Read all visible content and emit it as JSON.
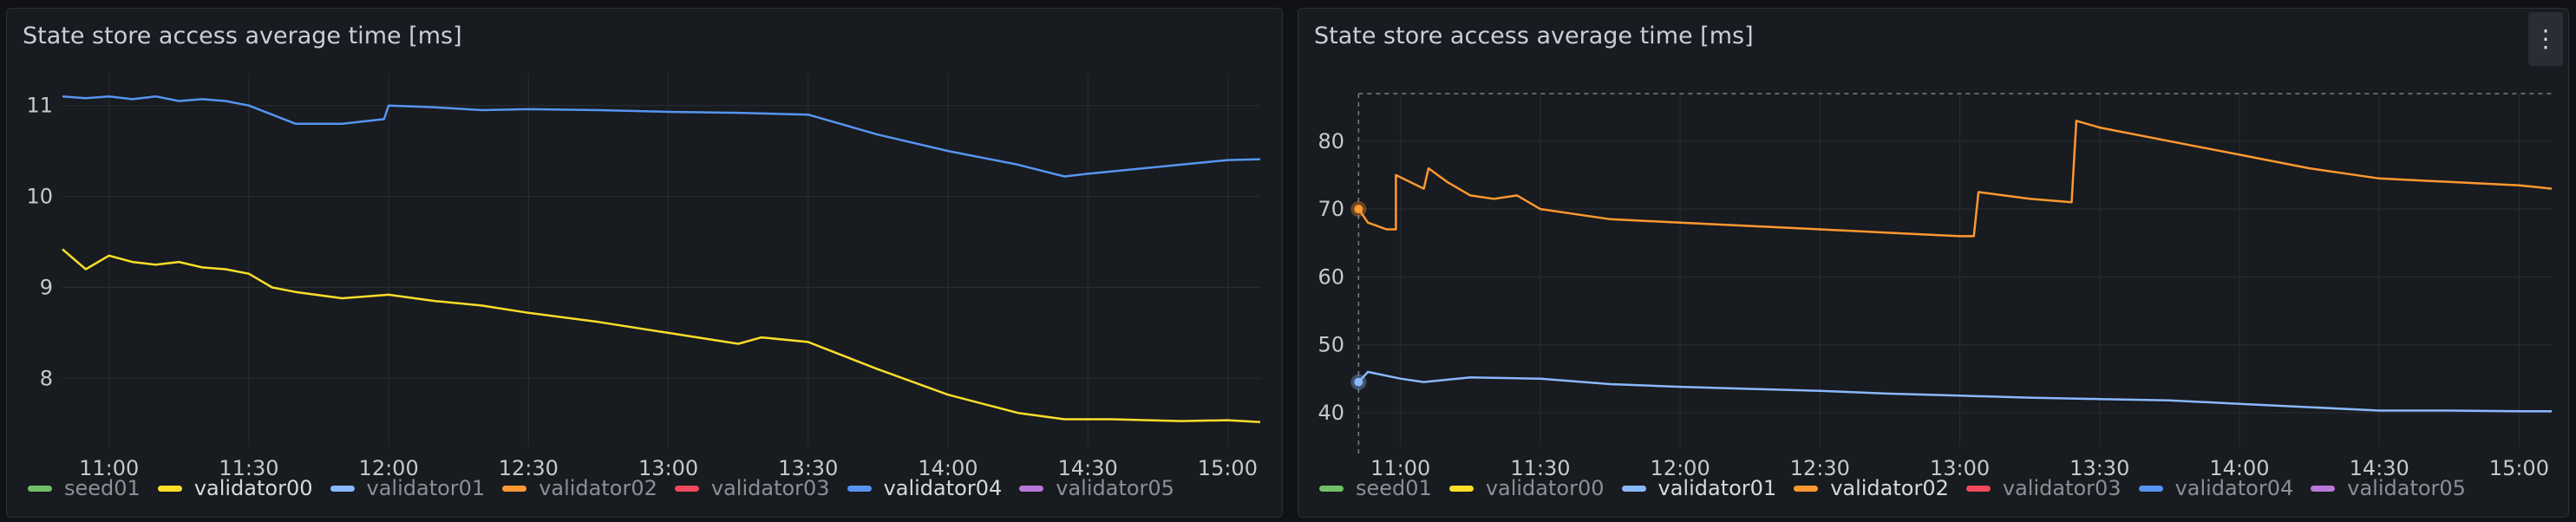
{
  "panels": [
    {
      "title": "State store access average time [ms]"
    },
    {
      "title": "State store access average time [ms]",
      "menu_icon": "⋮"
    }
  ],
  "colors": {
    "seed01": "#73bf69",
    "validator00": "#fade2a",
    "validator01": "#8ab8ff",
    "validator02": "#ff9830",
    "validator03": "#f2495c",
    "validator04": "#5794f2",
    "validator05": "#b877d9",
    "grid": "#2a2d33",
    "axis_text": "#c7c8cc"
  },
  "chart_data": [
    {
      "type": "line",
      "title": "State store access average time [ms]",
      "xlabel": "",
      "ylabel": "",
      "x_ticks": [
        "11:00",
        "11:30",
        "12:00",
        "12:30",
        "13:00",
        "13:30",
        "14:00",
        "14:30",
        "15:00"
      ],
      "y_ticks": [
        8,
        9,
        10,
        11
      ],
      "xlim": [
        "10:50",
        "15:07"
      ],
      "ylim": [
        7.25,
        11.35
      ],
      "grid": true,
      "legend_position": "bottom-left",
      "legend": [
        {
          "name": "seed01",
          "active": false
        },
        {
          "name": "validator00",
          "active": true
        },
        {
          "name": "validator01",
          "active": false
        },
        {
          "name": "validator02",
          "active": false
        },
        {
          "name": "validator03",
          "active": false
        },
        {
          "name": "validator04",
          "active": true
        },
        {
          "name": "validator05",
          "active": false
        }
      ],
      "series": [
        {
          "name": "validator04",
          "x": [
            "10:50",
            "10:55",
            "11:00",
            "11:05",
            "11:10",
            "11:15",
            "11:20",
            "11:25",
            "11:30",
            "11:40",
            "11:50",
            "11:59",
            "12:00",
            "12:10",
            "12:20",
            "12:30",
            "12:45",
            "13:00",
            "13:15",
            "13:30",
            "13:45",
            "14:00",
            "14:15",
            "14:25",
            "14:30",
            "14:40",
            "14:50",
            "15:00",
            "15:07"
          ],
          "values": [
            11.1,
            11.08,
            11.1,
            11.07,
            11.1,
            11.05,
            11.07,
            11.05,
            11.0,
            10.8,
            10.8,
            10.85,
            11.0,
            10.98,
            10.95,
            10.96,
            10.95,
            10.93,
            10.92,
            10.9,
            10.68,
            10.5,
            10.35,
            10.22,
            10.25,
            10.3,
            10.35,
            10.4,
            10.41
          ]
        },
        {
          "name": "validator00",
          "x": [
            "10:50",
            "10:55",
            "11:00",
            "11:05",
            "11:10",
            "11:15",
            "11:20",
            "11:25",
            "11:30",
            "11:35",
            "11:40",
            "11:50",
            "12:00",
            "12:10",
            "12:20",
            "12:30",
            "12:45",
            "13:00",
            "13:15",
            "13:20",
            "13:30",
            "13:45",
            "14:00",
            "14:15",
            "14:25",
            "14:35",
            "14:50",
            "15:00",
            "15:07"
          ],
          "values": [
            9.42,
            9.2,
            9.35,
            9.28,
            9.25,
            9.28,
            9.22,
            9.2,
            9.15,
            9.0,
            8.95,
            8.88,
            8.92,
            8.85,
            8.8,
            8.72,
            8.62,
            8.5,
            8.38,
            8.45,
            8.4,
            8.1,
            7.82,
            7.62,
            7.55,
            7.55,
            7.53,
            7.54,
            7.52
          ]
        }
      ]
    },
    {
      "type": "line",
      "title": "State store access average time [ms]",
      "xlabel": "",
      "ylabel": "",
      "x_ticks": [
        "11:00",
        "11:30",
        "12:00",
        "12:30",
        "13:00",
        "13:30",
        "14:00",
        "14:30",
        "15:00"
      ],
      "y_ticks": [
        40,
        50,
        60,
        70,
        80
      ],
      "xlim": [
        "10:50",
        "15:07"
      ],
      "ylim": [
        35,
        87
      ],
      "grid": true,
      "legend_position": "bottom-left",
      "legend": [
        {
          "name": "seed01",
          "active": false
        },
        {
          "name": "validator00",
          "active": false
        },
        {
          "name": "validator01",
          "active": true
        },
        {
          "name": "validator02",
          "active": true
        },
        {
          "name": "validator03",
          "active": false
        },
        {
          "name": "validator04",
          "active": false
        },
        {
          "name": "validator05",
          "active": false
        }
      ],
      "series": [
        {
          "name": "validator02",
          "x": [
            "10:51",
            "10:53",
            "10:57",
            "10:59",
            "10:59",
            "11:02",
            "11:05",
            "11:06",
            "11:10",
            "11:15",
            "11:20",
            "11:25",
            "11:30",
            "11:45",
            "12:00",
            "12:15",
            "12:30",
            "12:45",
            "13:00",
            "13:03",
            "13:04",
            "13:15",
            "13:24",
            "13:25",
            "13:30",
            "13:45",
            "14:00",
            "14:15",
            "14:30",
            "14:45",
            "15:00",
            "15:07"
          ],
          "values": [
            70,
            68,
            67,
            67,
            75,
            74,
            73,
            76,
            74,
            72,
            71.5,
            72,
            70,
            68.5,
            68,
            67.5,
            67,
            66.5,
            66,
            66,
            72.5,
            71.5,
            71,
            83,
            82,
            80,
            78,
            76,
            74.5,
            74,
            73.5,
            73
          ]
        },
        {
          "name": "validator01",
          "x": [
            "10:51",
            "10:53",
            "11:00",
            "11:05",
            "11:15",
            "11:30",
            "11:45",
            "12:00",
            "12:15",
            "12:30",
            "12:45",
            "13:00",
            "13:15",
            "13:30",
            "13:45",
            "14:00",
            "14:15",
            "14:30",
            "14:45",
            "15:00",
            "15:07"
          ],
          "values": [
            44.5,
            46,
            45,
            44.5,
            45.2,
            45,
            44.2,
            43.8,
            43.5,
            43.2,
            42.8,
            42.5,
            42.2,
            42,
            41.8,
            41.3,
            40.8,
            40.3,
            40.3,
            40.2,
            40.2
          ]
        }
      ],
      "highlight_points": [
        {
          "series": "validator02",
          "x": "10:51",
          "value": 70
        },
        {
          "series": "validator01",
          "x": "10:51",
          "value": 44.5
        }
      ],
      "crosshair_x": "10:51"
    }
  ]
}
